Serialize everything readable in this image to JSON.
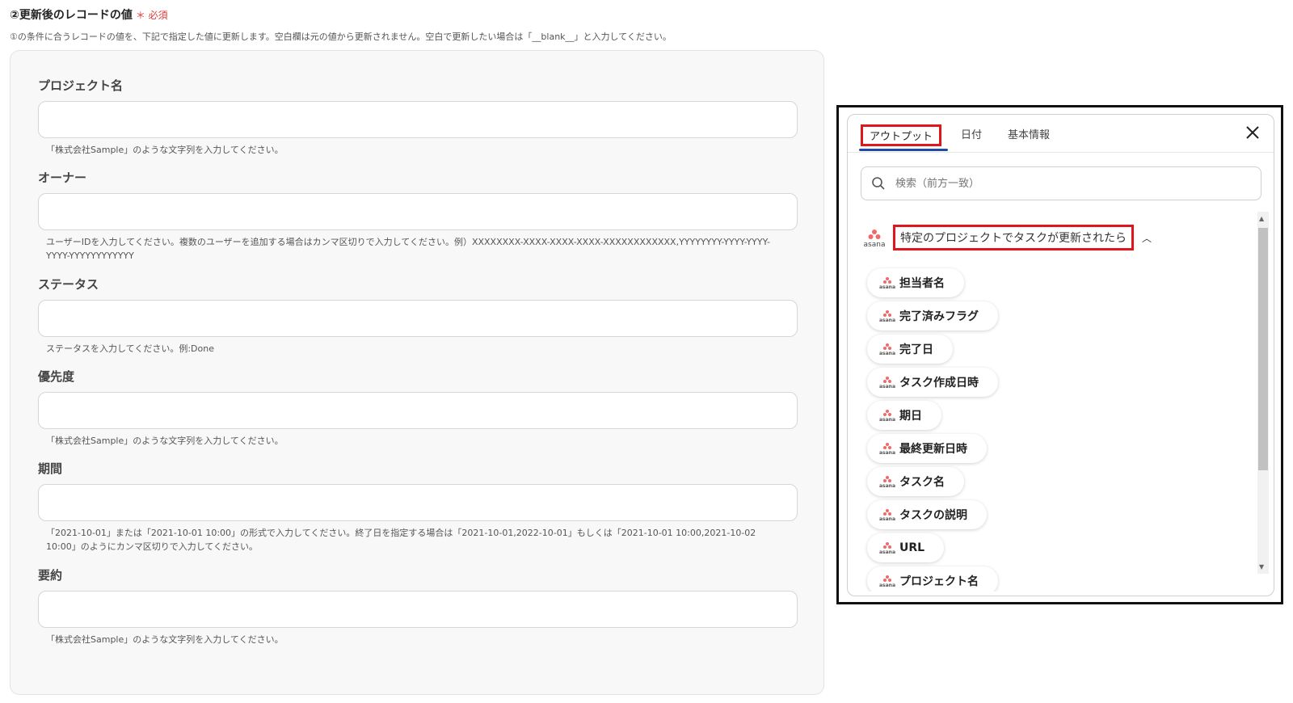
{
  "section": {
    "title": "②更新後のレコードの値",
    "required": "＊ 必須",
    "description": "①の条件に合うレコードの値を、下記で指定した値に更新します。空白欄は元の値から更新されません。空白で更新したい場合は「__blank__」と入力してください。"
  },
  "fields": [
    {
      "label": "プロジェクト名",
      "value": "",
      "help": "「株式会社Sample」のような文字列を入力してください。"
    },
    {
      "label": "オーナー",
      "value": "",
      "help": "ユーザーIDを入力してください。複数のユーザーを追加する場合はカンマ区切りで入力してください。例）XXXXXXXX-XXXX-XXXX-XXXX-XXXXXXXXXXXX,YYYYYYYY-YYYY-YYYY-YYYY-YYYYYYYYYYYY"
    },
    {
      "label": "ステータス",
      "value": "",
      "help": "ステータスを入力してください。例:Done"
    },
    {
      "label": "優先度",
      "value": "",
      "help": "「株式会社Sample」のような文字列を入力してください。"
    },
    {
      "label": "期間",
      "value": "",
      "help": "「2021-10-01」または「2021-10-01 10:00」の形式で入力してください。終了日を指定する場合は「2021-10-01,2022-10-01」もしくは「2021-10-01 10:00,2021-10-02 10:00」のようにカンマ区切りで入力してください。"
    },
    {
      "label": "要約",
      "value": "",
      "help": "「株式会社Sample」のような文字列を入力してください。"
    }
  ],
  "panel": {
    "tabs": {
      "output": "アウトプット",
      "date": "日付",
      "info": "基本情報"
    },
    "search_placeholder": "検索（前方一致）",
    "group": {
      "logo_text": "asana",
      "title": "特定のプロジェクトでタスクが更新されたら"
    },
    "items": [
      "担当者名",
      "完了済みフラグ",
      "完了日",
      "タスク作成日時",
      "期日",
      "最終更新日時",
      "タスク名",
      "タスクの説明",
      "URL",
      "プロジェクト名"
    ],
    "mini_logo_text": "asana",
    "accent_color": "#e0161d",
    "tab_indicator_color": "#1f4aa5",
    "asana_color": "#f06a6a"
  }
}
